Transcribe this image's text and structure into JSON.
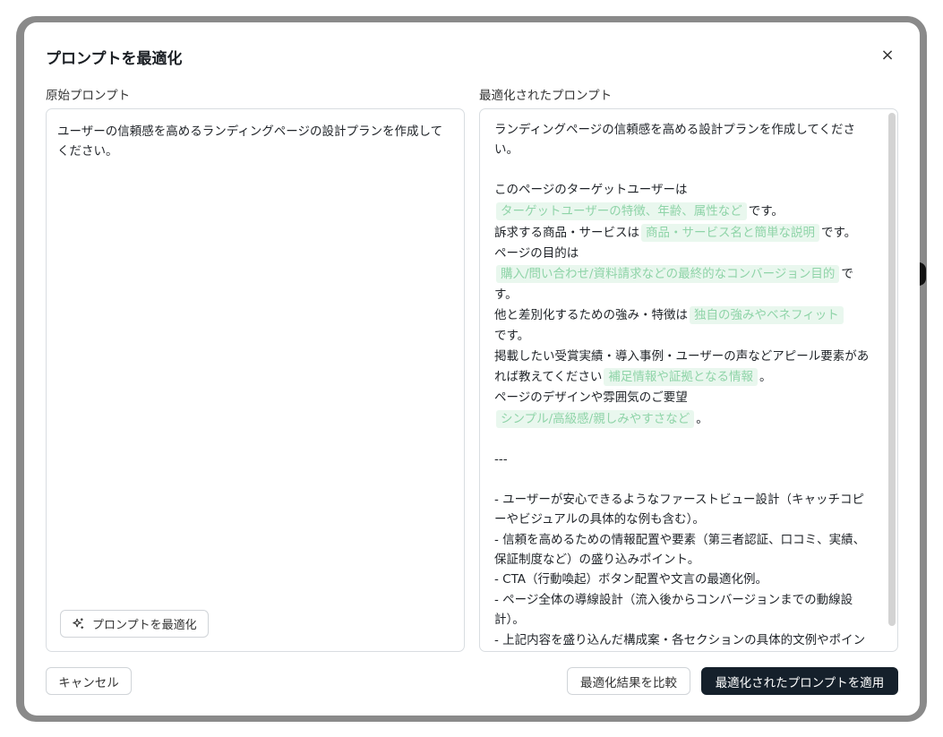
{
  "dialog": {
    "title": "プロンプトを最適化",
    "close_symbol": "×"
  },
  "original": {
    "label": "原始プロンプト",
    "text": "ユーザーの信頼感を高めるランディングページの設計プランを作成してください。",
    "optimize_button": "プロンプトを最適化",
    "optimize_icon": "sparkle-icon"
  },
  "optimized": {
    "label": "最適化されたプロンプト",
    "intro": "ランディングページの信頼感を高める設計プランを作成してください。",
    "target_prefix": "このページのターゲットユーザーは",
    "target_ph": "ターゲットユーザーの特徴、年齢、属性など",
    "target_suffix": "です。",
    "product_prefix": "訴求する商品・サービスは",
    "product_ph": "商品・サービス名と簡単な説明",
    "product_suffix": "です。",
    "goal_prefix": "ページの目的は",
    "goal_ph": "購入/問い合わせ/資料請求などの最終的なコンバージョン目的",
    "goal_suffix": "です。",
    "strength_prefix": "他と差別化するための強み・特徴は",
    "strength_ph": "独自の強みやベネフィット",
    "strength_suffix": "です。",
    "proof_prefix": "掲載したい受賞実績・導入事例・ユーザーの声などアピール要素があれば教えてください",
    "proof_ph": "補足情報や証拠となる情報",
    "proof_suffix": "。",
    "design_prefix": "ページのデザインや雰囲気のご要望",
    "design_ph": "シンプル/高級感/親しみやすさなど",
    "design_suffix": "。",
    "separator": "---",
    "bullets": [
      "- ユーザーが安心できるようなファーストビュー設計（キャッチコピーやビジュアルの具体的な例も含む）。",
      "- 信頼を高めるための情報配置や要素（第三者認証、口コミ、実績、保証制度など）の盛り込みポイント。",
      "- CTA（行動喚起）ボタン配置や文言の最適化例。",
      "- ページ全体の導線設計（流入後からコンバージョンまでの動線設計）。",
      "- 上記内容を盛り込んだ構成案・各セクションの具体的文例やポイントまで日本語でわかりやすくまとめてください。"
    ]
  },
  "footer": {
    "cancel": "キャンセル",
    "compare": "最適化結果を比較",
    "apply": "最適化されたプロンプトを適用"
  }
}
